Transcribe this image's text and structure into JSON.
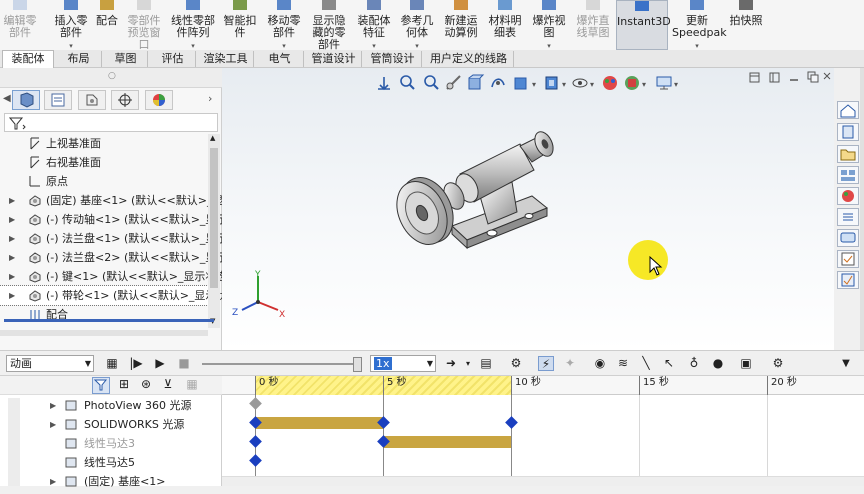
{
  "ribbon": {
    "buttons": [
      {
        "id": "edit_component",
        "label": "编辑零\n部件",
        "dim": true,
        "arrow": false
      },
      {
        "id": "insert_component",
        "label": "插入零\n部件",
        "dim": false,
        "arrow": true
      },
      {
        "id": "mate",
        "label": "配合",
        "dim": false,
        "arrow": false
      },
      {
        "id": "component_preview",
        "label": "零部件\n预览窗\n口",
        "dim": true,
        "arrow": false
      },
      {
        "id": "linear_pattern",
        "label": "线性零部\n件阵列",
        "dim": false,
        "arrow": true
      },
      {
        "id": "smart_fasteners",
        "label": "智能扣\n件",
        "dim": false,
        "arrow": false
      },
      {
        "id": "move_component",
        "label": "移动零\n部件",
        "dim": false,
        "arrow": true
      },
      {
        "id": "show_hidden",
        "label": "显示隐\n藏的零\n部件",
        "dim": false,
        "arrow": false
      },
      {
        "id": "assembly_features",
        "label": "装配体\n特征",
        "dim": false,
        "arrow": true
      },
      {
        "id": "reference_geometry",
        "label": "参考几\n何体",
        "dim": false,
        "arrow": true
      },
      {
        "id": "new_motion_study",
        "label": "新建运\n动算例",
        "dim": false,
        "arrow": false
      },
      {
        "id": "bom",
        "label": "材料明\n细表",
        "dim": false,
        "arrow": false
      },
      {
        "id": "exploded_view",
        "label": "爆炸视\n图",
        "dim": false,
        "arrow": true
      },
      {
        "id": "explode_line",
        "label": "爆炸直\n线草图",
        "dim": true,
        "arrow": false
      },
      {
        "id": "instant3d",
        "label": "Instant3D",
        "dim": false,
        "arrow": false,
        "active": true
      },
      {
        "id": "update_speedpak",
        "label": "更新\nSpeedpak",
        "dim": false,
        "arrow": true
      },
      {
        "id": "snapshot",
        "label": "拍快照",
        "dim": false,
        "arrow": false
      }
    ]
  },
  "tabs": [
    "装配体",
    "布局",
    "草图",
    "评估",
    "渲染工具",
    "电气",
    "管道设计",
    "管筒设计",
    "用户定义的线路"
  ],
  "active_tab": "装配体",
  "feature_tree": {
    "items": [
      {
        "label": "上视基准面",
        "type": "plane",
        "expandable": false
      },
      {
        "label": "右视基准面",
        "type": "plane",
        "expandable": false
      },
      {
        "label": "原点",
        "type": "origin",
        "expandable": false
      },
      {
        "label": "(固定) 基座<1> (默认<<默认>_显",
        "type": "part",
        "expandable": true
      },
      {
        "label": "(-) 传动轴<1> (默认<<默认>_显示",
        "type": "part",
        "expandable": true
      },
      {
        "label": "(-) 法兰盘<1> (默认<<默认>_显示",
        "type": "part",
        "expandable": true
      },
      {
        "label": "(-) 法兰盘<2> (默认<<默认>_显示",
        "type": "part",
        "expandable": true
      },
      {
        "label": "(-) 键<1> (默认<<默认>_显示状态",
        "type": "part",
        "expandable": true
      },
      {
        "label": "(-) 带轮<1> (默认<<默认>_显示状",
        "type": "part",
        "expandable": true,
        "selected": true
      },
      {
        "label": "配合",
        "type": "mates",
        "expandable": false
      }
    ]
  },
  "triad": {
    "x": "X",
    "y": "Y",
    "z": "Z"
  },
  "motion": {
    "study_type": "动画",
    "speed": "1x",
    "tree": [
      {
        "label": "PhotoView 360 光源",
        "expandable": true
      },
      {
        "label": "SOLIDWORKS 光源",
        "expandable": true
      },
      {
        "label": "线性马达3",
        "expandable": false,
        "dim": true
      },
      {
        "label": "线性马达5",
        "expandable": false
      },
      {
        "label": "(固定) 基座<1>",
        "expandable": true
      }
    ],
    "ticks": [
      "0 秒",
      "5 秒",
      "10 秒",
      "15 秒",
      "20 秒"
    ],
    "highlight_seconds": [
      0,
      10
    ],
    "keyframes": [
      {
        "row": 0,
        "t": 0,
        "gray": true
      },
      {
        "row": 1,
        "t": 0
      },
      {
        "row": 1,
        "t": 5
      },
      {
        "row": 1,
        "t": 10
      },
      {
        "row": 2,
        "t": 0
      },
      {
        "row": 2,
        "t": 5
      },
      {
        "row": 3,
        "t": 0
      }
    ],
    "bars": [
      {
        "row": 1,
        "from": 0,
        "to": 5
      },
      {
        "row": 2,
        "from": 5,
        "to": 10
      }
    ]
  },
  "colors": {
    "accent": "#1a3fbf",
    "bar": "#c9a541",
    "highlight": "#fff38a"
  }
}
